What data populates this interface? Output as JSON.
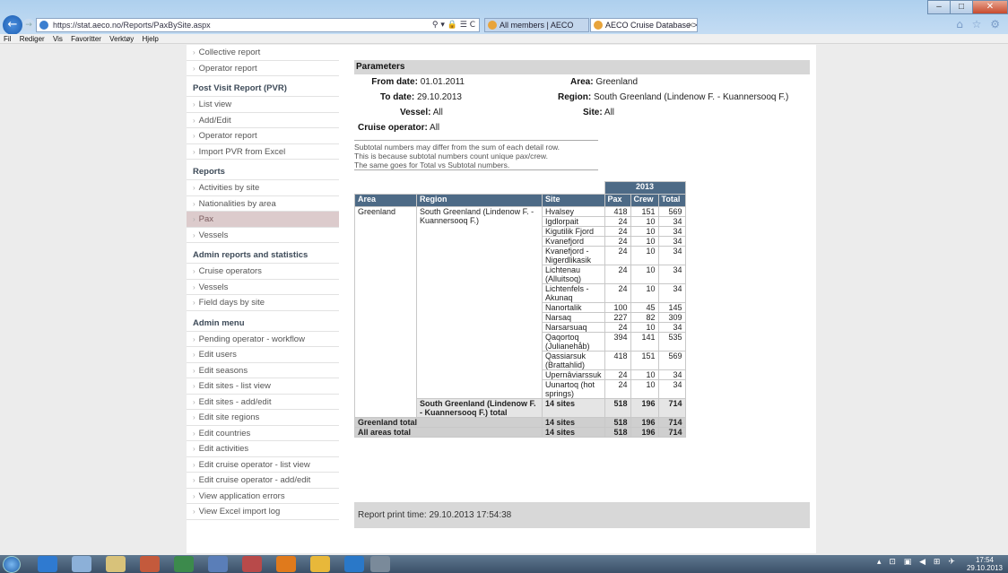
{
  "browser": {
    "url": "https://stat.aeco.no/Reports/PaxBySite.aspx",
    "addr_tools": "⚲ ▾ 🔒 ☰ C",
    "tabs": [
      {
        "label": "All members | AECO"
      },
      {
        "label": "AECO Cruise Database > Re...",
        "close": "✕"
      }
    ],
    "menu": [
      "Fil",
      "Rediger",
      "Vis",
      "Favoritter",
      "Verktøy",
      "Hjelp"
    ],
    "toolbar_icons": "⌂ ☆ ⚙"
  },
  "sidebar": {
    "top_items": [
      "Collective report",
      "Operator report"
    ],
    "sections": [
      {
        "heading": "Post Visit Report (PVR)",
        "items": [
          "List view",
          "Add/Edit",
          "Operator report",
          "Import PVR from Excel"
        ]
      },
      {
        "heading": "Reports",
        "items": [
          "Activities by site",
          "Nationalities by area",
          "Pax",
          "Vessels"
        ]
      },
      {
        "heading": "Admin reports and statistics",
        "items": [
          "Cruise operators",
          "Vessels",
          "Field days by site"
        ]
      },
      {
        "heading": "Admin menu",
        "items": [
          "Pending operator - workflow",
          "Edit users",
          "Edit seasons",
          "Edit sites - list view",
          "Edit sites - add/edit",
          "Edit site regions",
          "Edit countries",
          "Edit activities",
          "Edit cruise operator - list view",
          "Edit cruise operator - add/edit",
          "View application errors",
          "View Excel import log"
        ]
      }
    ]
  },
  "params": {
    "heading": "Parameters",
    "from_label": "From date:",
    "from_value": "01.01.2011",
    "to_label": "To date:",
    "to_value": "29.10.2013",
    "vessel_label": "Vessel:",
    "vessel_value": "All",
    "operator_label": "Cruise operator:",
    "operator_value": "All",
    "area_label": "Area:",
    "area_value": "Greenland",
    "region_label": "Region:",
    "region_value": "South Greenland (Lindenow F. - Kuannersooq F.)",
    "site_label": "Site:",
    "site_value": "All"
  },
  "note": {
    "line1": "Subtotal numbers may differ from the sum of each detail row.",
    "line2": "This is because subtotal numbers count unique pax/crew.",
    "line3": "The same goes for Total vs Subtotal numbers."
  },
  "table": {
    "year": "2013",
    "headers": [
      "Area",
      "Region",
      "Site",
      "Pax",
      "Crew",
      "Total"
    ],
    "area": "Greenland",
    "region": "South Greenland (Lindenow F. - Kuannersooq F.)",
    "rows": [
      {
        "site": "Hvalsey",
        "pax": "418",
        "crew": "151",
        "total": "569"
      },
      {
        "site": "Igdlorpait",
        "pax": "24",
        "crew": "10",
        "total": "34"
      },
      {
        "site": "Kigutilik Fjord",
        "pax": "24",
        "crew": "10",
        "total": "34"
      },
      {
        "site": "Kvanefjord",
        "pax": "24",
        "crew": "10",
        "total": "34"
      },
      {
        "site": "Kvanefjord - Nigerdlikasik",
        "pax": "24",
        "crew": "10",
        "total": "34"
      },
      {
        "site": "Lichtenau (Alluitsoq)",
        "pax": "24",
        "crew": "10",
        "total": "34"
      },
      {
        "site": "Lichtenfels - Akunaq",
        "pax": "24",
        "crew": "10",
        "total": "34"
      },
      {
        "site": "Nanortalik",
        "pax": "100",
        "crew": "45",
        "total": "145"
      },
      {
        "site": "Narsaq",
        "pax": "227",
        "crew": "82",
        "total": "309"
      },
      {
        "site": "Narsarsuaq",
        "pax": "24",
        "crew": "10",
        "total": "34"
      },
      {
        "site": "Qaqortoq (Julianehåb)",
        "pax": "394",
        "crew": "141",
        "total": "535"
      },
      {
        "site": "Qassiarsuk (Brattahlid)",
        "pax": "418",
        "crew": "151",
        "total": "569"
      },
      {
        "site": "Upernâviarssuk",
        "pax": "24",
        "crew": "10",
        "total": "34"
      },
      {
        "site": "Uunartoq (hot springs)",
        "pax": "24",
        "crew": "10",
        "total": "34"
      }
    ],
    "region_total": {
      "label": "South Greenland (Lindenow F. - Kuannersooq F.) total",
      "sites": "14 sites",
      "pax": "518",
      "crew": "196",
      "total": "714"
    },
    "area_total": {
      "label": "Greenland total",
      "sites": "14 sites",
      "pax": "518",
      "crew": "196",
      "total": "714"
    },
    "all_total": {
      "label": "All areas total",
      "sites": "14 sites",
      "pax": "518",
      "crew": "196",
      "total": "714"
    }
  },
  "print_time": "Report print time: 29.10.2013 17:54:38",
  "taskbar": {
    "tray_icons": "▴ ⊡ ▣ ◀ ⊞ ✈",
    "time": "17:54",
    "date": "29.10.2013"
  },
  "colors": {
    "table_header": "#4d6a86",
    "active_nav": "#dccbcc",
    "param_bar": "#d6d6d6"
  }
}
